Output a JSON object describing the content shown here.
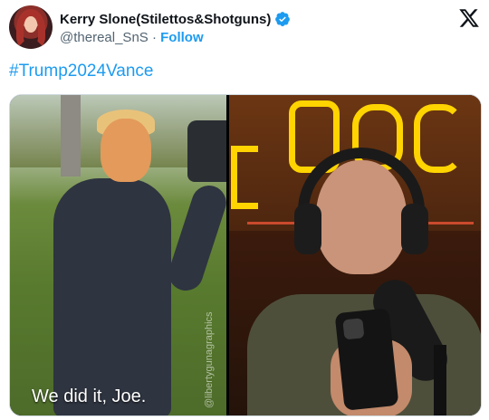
{
  "tweet": {
    "author": {
      "display_name": "Kerry Slone(Stilettos&Shotguns)",
      "handle": "@thereal_SnS",
      "separator": "·",
      "follow_label": "Follow",
      "verified_icon": "verified-badge-icon"
    },
    "platform_icon": "x-logo-icon",
    "text": "#Trump2024Vance",
    "media": {
      "left_caption": "We did it, Joe.",
      "left_watermark": "@libertygunagraphics",
      "right_sign_icon": "rogan-neon-sign"
    }
  },
  "colors": {
    "accent": "#1d9bf0",
    "text_primary": "#0f1419",
    "text_secondary": "#536471",
    "border": "#cfd9de"
  }
}
